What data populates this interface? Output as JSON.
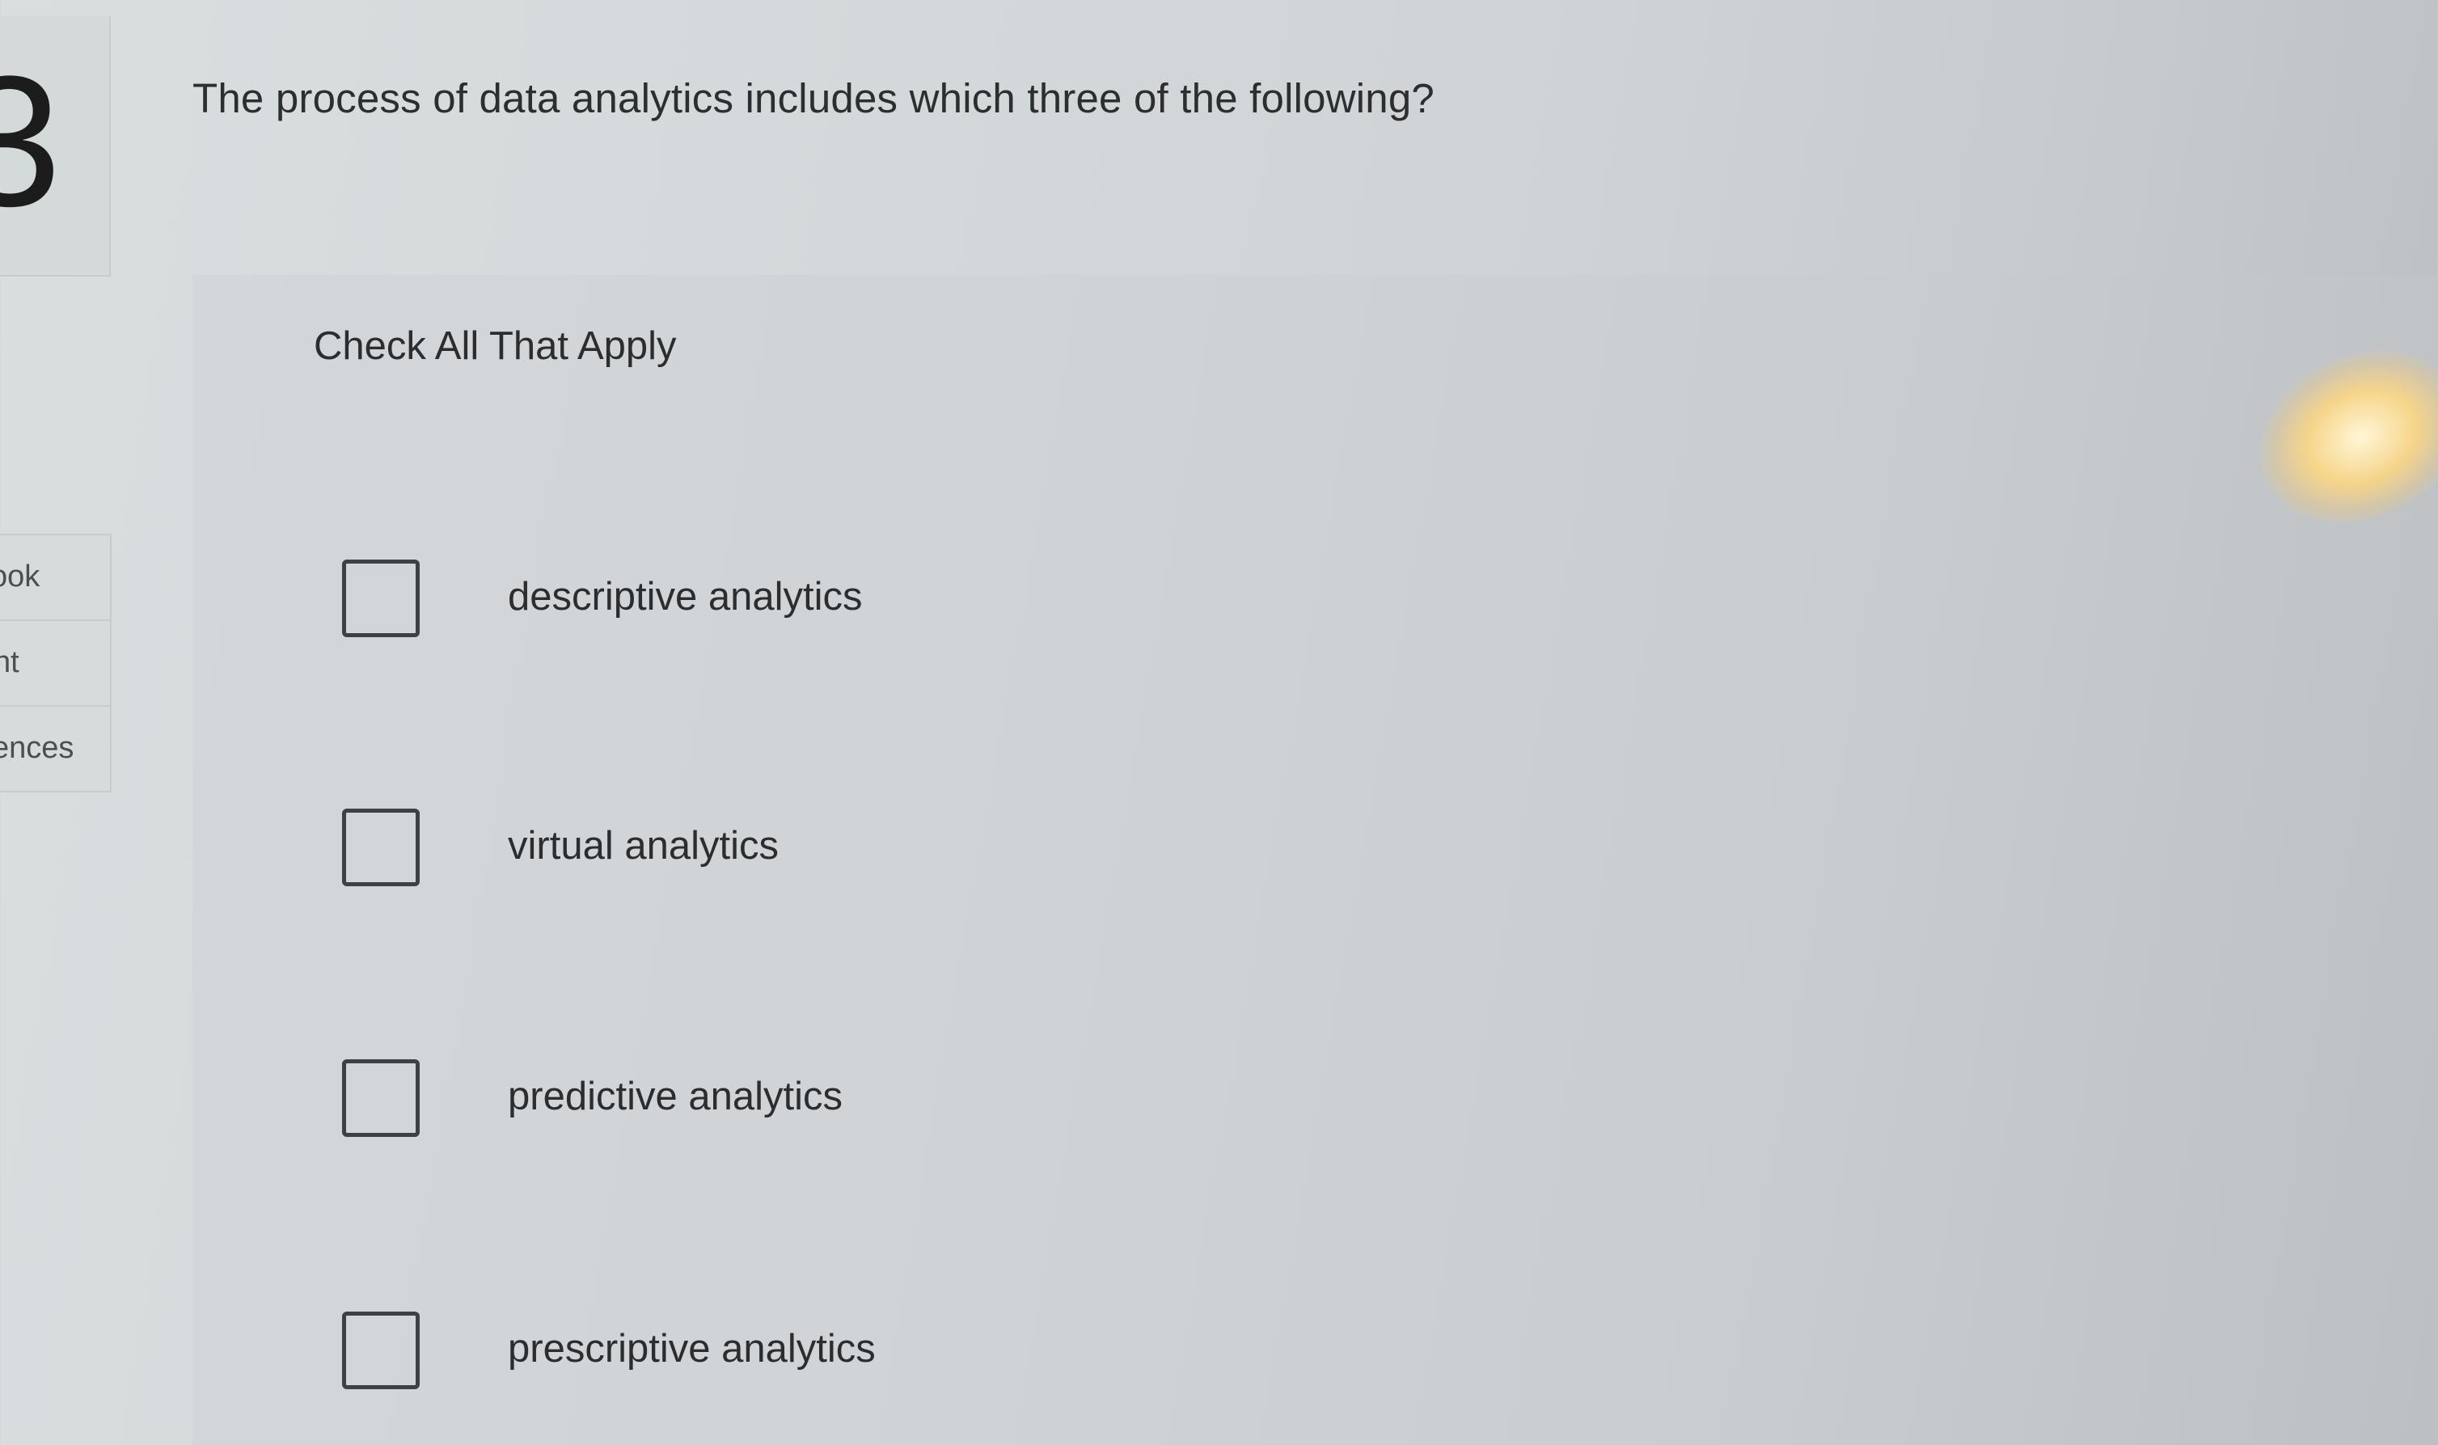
{
  "question": {
    "number": "3",
    "text": "The process of data analytics includes which three of the following?"
  },
  "nav": {
    "ebook": "ook",
    "print": "nt",
    "references": "ences"
  },
  "answers": {
    "instruction": "Check All That Apply",
    "options": [
      {
        "label": "descriptive analytics",
        "checked": false
      },
      {
        "label": "virtual analytics",
        "checked": false
      },
      {
        "label": "predictive analytics",
        "checked": false
      },
      {
        "label": "prescriptive analytics",
        "checked": false
      }
    ]
  }
}
